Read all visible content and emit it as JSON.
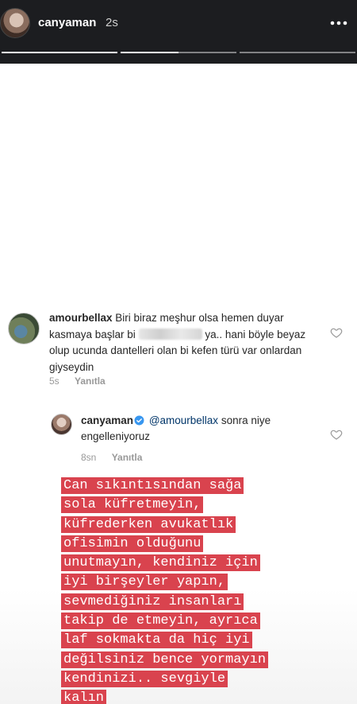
{
  "story": {
    "username": "canyaman",
    "time": "2s",
    "progress": [
      1.0,
      0.5,
      0.0
    ]
  },
  "comment1": {
    "username": "amourbellax",
    "text_before_blur": "Biri biraz meşhur olsa hemen duyar kasmaya başlar bi",
    "text_after_blur": "ya.. hani böyle beyaz olup ucunda dantelleri olan bi kefen türü var onlardan giyseydin",
    "time": "5s",
    "reply_label": "Yanıtla"
  },
  "comment2": {
    "username": "canyaman",
    "mention": "@amourbellax",
    "text": "sonra niye engelleniyoruz",
    "time": "8sn",
    "reply_label": "Yanıtla"
  },
  "statement": {
    "lines": [
      "Can sıkıntısından sağa",
      "sola küfretmeyin,",
      "küfrederken avukatlık",
      "ofisimin olduğunu",
      "unutmayın, kendiniz için",
      "iyi birşeyler yapın,",
      "sevmediğiniz insanları",
      "takip de etmeyin, ayrıca",
      "laf sokmakta da hiç iyi",
      "değilsiniz bence yormayın",
      "kendinizi.. sevgiyle",
      "kalın"
    ],
    "highlight_color": "#d9434e"
  },
  "icons": {
    "more": "more-icon",
    "heart": "heart-icon",
    "verified": "verified-badge-icon"
  }
}
